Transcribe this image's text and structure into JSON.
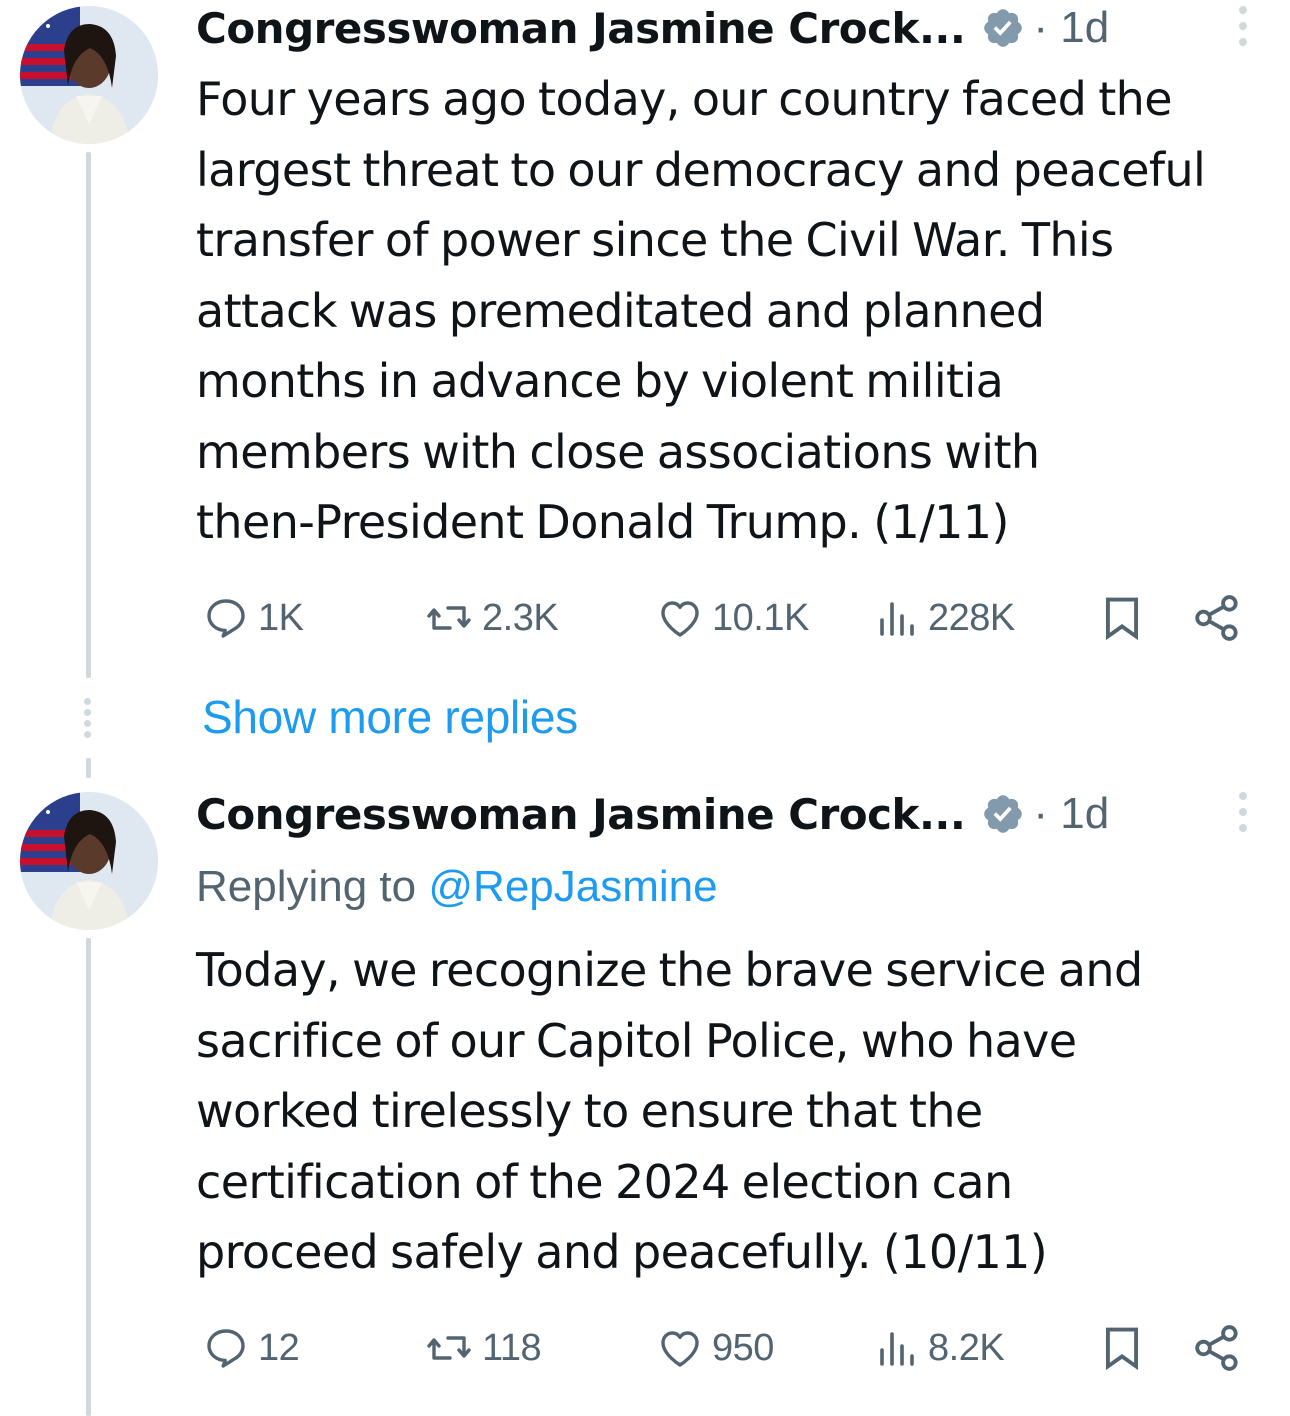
{
  "tweets": [
    {
      "author_name": "Congresswoman Jasmine Crock...",
      "time": "· 1d",
      "replying_label": "",
      "replying_handle": "",
      "text": "Four years ago today, our country faced the\nlargest threat to our democracy and peaceful\ntransfer of power since the Civil War. This\nattack was premeditated and planned\nmonths in advance by violent militia\nmembers with close associations with\nthen-President Donald Trump. (1/11)",
      "replies": "1K",
      "reposts": "2.3K",
      "likes": "10.1K",
      "views": "228K"
    },
    {
      "author_name": "Congresswoman Jasmine Crock...",
      "time": "· 1d",
      "replying_label": "Replying to",
      "replying_handle": "@RepJasmine",
      "text": "Today, we recognize the brave service and\nsacrifice of our Capitol Police, who have\nworked tirelessly to ensure that the\ncertification of the 2024 election can\nproceed safely and peacefully. (10/11)",
      "replies": "12",
      "reposts": "118",
      "likes": "950",
      "views": "8.2K"
    }
  ],
  "show_more_replies": "Show more replies",
  "icons": {
    "reply": "reply-icon",
    "repost": "repost-icon",
    "like": "heart-icon",
    "views": "views-icon",
    "bookmark": "bookmark-icon",
    "share": "share-icon",
    "verified": "verified-badge-icon",
    "more": "more-options-icon"
  },
  "colors": {
    "text": "#0f1419",
    "secondary": "#536471",
    "link": "#1d9bf0",
    "thread_line": "#cfd9de",
    "verified_badge": "#829aab"
  }
}
